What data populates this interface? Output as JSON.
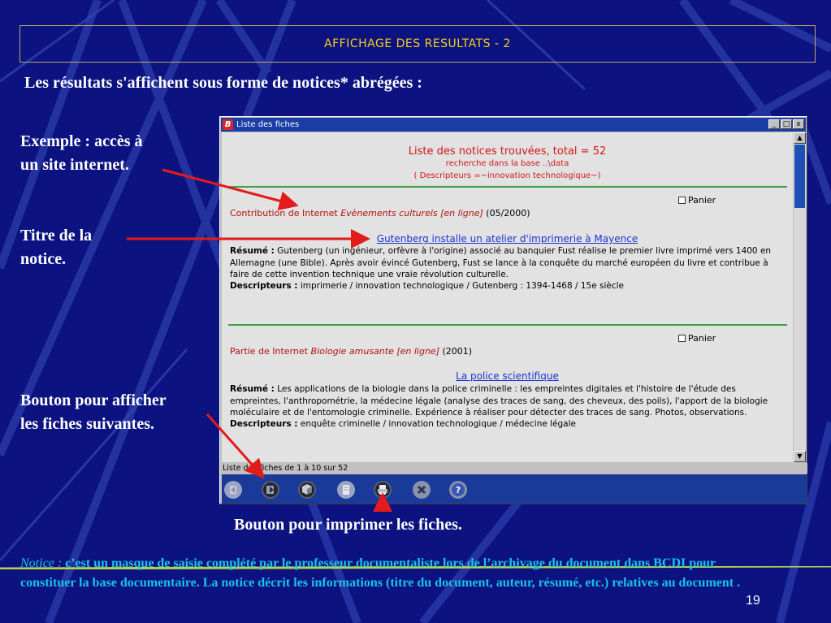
{
  "slide": {
    "title": "AFFICHAGE DES RESULTATS - 2",
    "intro": "Les résultats s'affichent sous  forme de notices* abrégées :",
    "captions": {
      "example_line1": "Exemple : accès à",
      "example_line2": "un site internet.",
      "title_line1": "Titre de la",
      "title_line2": "notice.",
      "next_line1": "Bouton pour afficher",
      "next_line2": "les fiches suivantes.",
      "print": "Bouton pour imprimer les fiches."
    },
    "footnote_term": "Notice :",
    "footnote_text": " c’est un masque de saisie complété par le professeur documentaliste lors de l’archivage du document dans BCDI pour constituer la base documentaire. La notice décrit les informations (titre du document, auteur, résumé, etc.) relatives au document .",
    "page_number": "19"
  },
  "window": {
    "badge": "B",
    "title": "Liste des fiches",
    "buttons": {
      "minimize": "_",
      "maximize": "□",
      "close": "x"
    },
    "header": {
      "line1": "Liste des notices trouvées, total = 52",
      "line2": "recherche dans la base ..\\data",
      "line3": "( Descripteurs =~innovation technologique~)"
    },
    "records": [
      {
        "panier": "Panier",
        "source_prefix": "Contribution de  Internet ",
        "source_title": "Evènements culturels [en ligne]",
        "date": " (05/2000)",
        "link": "Gutenberg installe un atelier d'imprimerie à Mayence",
        "resume_label": "Résumé :",
        "resume": "   Gutenberg (un ingénieur, orfèvre à l'origine) associé au banquier Fust réalise le premier livre imprimé vers 1400 en Allemagne (une Bible). Après avoir évincé Gutenberg, Fust se lance à la conquête du marché européen du livre et contribue à faire de cette invention technique une vraie révolution culturelle.",
        "descripteurs_label": "Descripteurs :",
        "descripteurs": " imprimerie / innovation technologique / Gutenberg : 1394-1468 / 15e siècle"
      },
      {
        "panier": "Panier",
        "source_prefix": "Partie de  Internet ",
        "source_title": "Biologie amusante [en ligne]",
        "date": " (2001)",
        "link": "La police scientifique",
        "resume_label": "Résumé :",
        "resume": "   Les applications de la biologie dans la police criminelle : les empreintes digitales et l'histoire de l'étude des empreintes, l'anthropométrie, la médecine légale (analyse des traces de sang, des cheveux, des poils), l'apport de la biologie moléculaire et de l'entomologie criminelle. Expérience à réaliser pour détecter des traces de sang. Photos, observations.",
        "descripteurs_label": "Descripteurs :",
        "descripteurs": " enquête criminelle / innovation technologique / médecine légale"
      }
    ],
    "status": "Liste des fiches de 1 à 10 sur 52",
    "toolbar_icons": [
      "previous-icon",
      "next-icon",
      "cube-icon",
      "document-icon",
      "print-icon",
      "close-icon",
      "help-icon"
    ]
  }
}
